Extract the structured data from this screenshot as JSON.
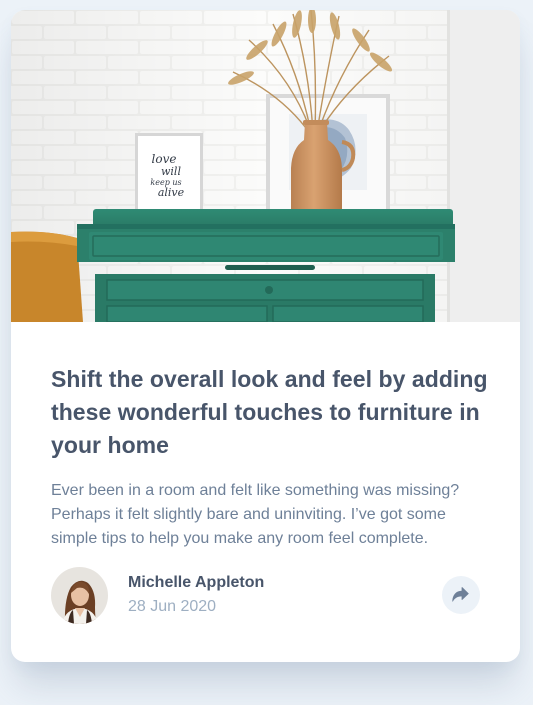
{
  "article": {
    "title": "Shift the overall look and feel by adding these wonderful touches to furniture in your home",
    "excerpt": "Ever been in a room and felt like something was missing? Perhaps it felt slightly bare and uninviting. I’ve got some simple tips to help you make any room feel complete.",
    "author": {
      "name": "Michelle Appleton",
      "date": "28 Jun 2020"
    }
  },
  "hero_image": {
    "frame_text": [
      "love",
      "will",
      "keep us",
      "alive"
    ]
  },
  "icons": {
    "share": "share-icon"
  },
  "colors": {
    "heading": "#48556a",
    "body_text": "#6e8098",
    "muted_text": "#9eafc2",
    "page_background": "#ecf2f8",
    "share_button_background": "#ecf2f8",
    "share_icon": "#6e8098",
    "drawer_green": "#2a7a66"
  }
}
